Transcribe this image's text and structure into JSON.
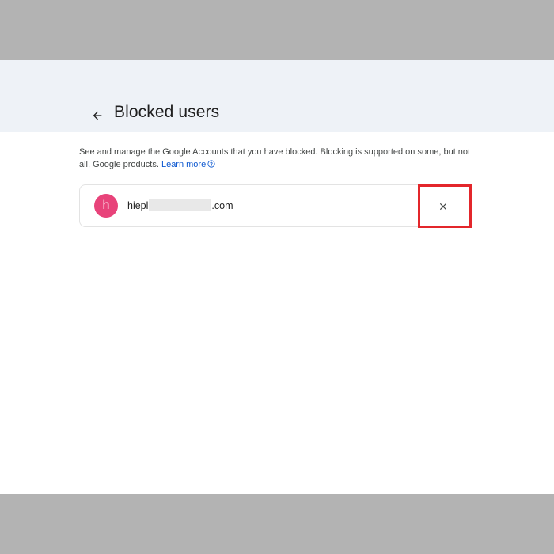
{
  "header": {
    "title": "Blocked users",
    "back_icon": "arrow-back-icon"
  },
  "description": {
    "text": "See and manage the Google Accounts that you have blocked. Blocking is supported on some, but not all, Google products.",
    "link_label": "Learn more",
    "help_icon": "help-circle-icon"
  },
  "blocked_users": [
    {
      "avatar_letter": "h",
      "avatar_color": "#e8437a",
      "email_start": "hiepl",
      "email_end": ".com",
      "remove_icon": "close-icon"
    }
  ],
  "colors": {
    "header_band": "#eef2f7",
    "link": "#0b57d0",
    "highlight": "#e3262b"
  }
}
